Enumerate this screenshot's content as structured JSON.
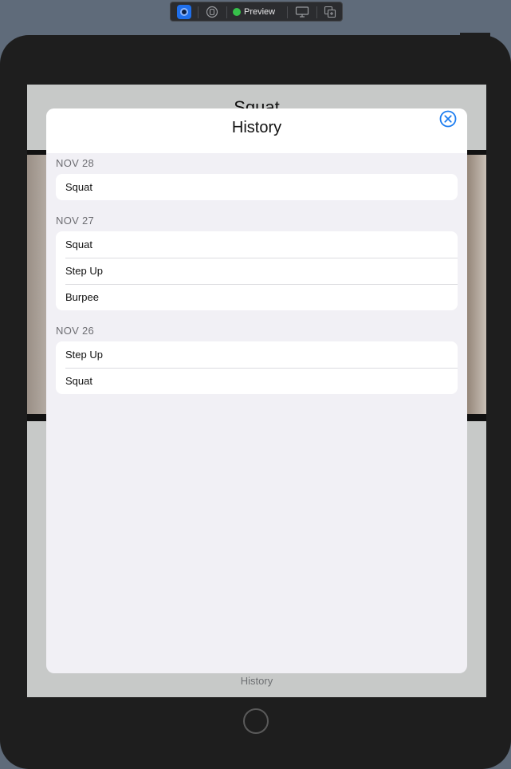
{
  "toolbar": {
    "preview_label": "Preview"
  },
  "background_screen": {
    "title": "Squat",
    "footer_label": "History"
  },
  "sheet": {
    "title": "History",
    "sections": [
      {
        "header": "NOV 28",
        "items": [
          "Squat"
        ]
      },
      {
        "header": "NOV 27",
        "items": [
          "Squat",
          "Step Up",
          "Burpee"
        ]
      },
      {
        "header": "NOV 26",
        "items": [
          "Step Up",
          "Squat"
        ]
      }
    ]
  },
  "colors": {
    "accent": "#1a7cf0",
    "sheet_background": "#f1f0f5",
    "row_background": "#ffffff"
  }
}
